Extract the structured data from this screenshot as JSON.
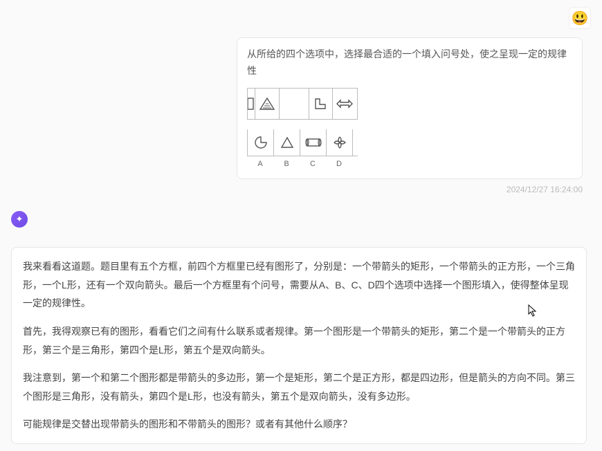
{
  "user": {
    "avatar_emoji": "😃",
    "message_text": "从所给的四个选项中，选择最合适的一个填入问号处，使之呈现一定的规律性",
    "options_labels": [
      "A",
      "B",
      "C",
      "D"
    ]
  },
  "timestamp": "2024/12/27 16:24:00",
  "ai": {
    "paragraphs": [
      "我来看看这道题。题目里有五个方框，前四个方框里已经有图形了，分别是：一个带箭头的矩形，一个带箭头的正方形，一个三角形，一个L形，还有一个双向箭头。最后一个方框里有个问号，需要从A、B、C、D四个选项中选择一个图形填入，使得整体呈现一定的规律性。",
      "首先，我得观察已有的图形，看看它们之间有什么联系或者规律。第一个图形是一个带箭头的矩形，第二个是一个带箭头的正方形，第三个是三角形，第四个是L形，第五个是双向箭头。",
      "我注意到，第一个和第二个图形都是带箭头的多边形，第一个是矩形，第二个是正方形，都是四边形，但是箭头的方向不同。第三个图形是三角形，没有箭头，第四个是L形，也没有箭头，第五个是双向箭头，没有多边形。",
      "可能规律是交替出现带箭头的图形和不带箭头的图形？或者有其他什么顺序？"
    ]
  },
  "icons": {
    "user_avatar": "user-emoji-icon",
    "ai_avatar": "ai-sparkle-icon"
  }
}
